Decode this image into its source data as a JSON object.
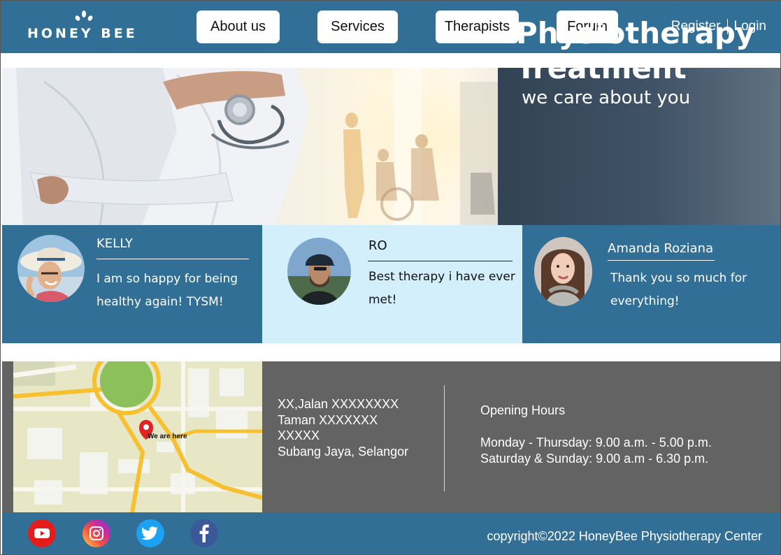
{
  "brand": {
    "name": "HONEY BEE"
  },
  "nav": {
    "items": [
      {
        "label": "About us"
      },
      {
        "label": "Services"
      },
      {
        "label": "Therapists"
      },
      {
        "label": "Forum"
      }
    ],
    "register_label": "Register",
    "login_label": "Login"
  },
  "hero": {
    "title_line1": "Physiotherapy",
    "title_line2": "Treatment",
    "subtitle": "we care about you"
  },
  "testimonials": [
    {
      "name": "KELLY",
      "text": "I am so happy for being healthy again! TYSM!"
    },
    {
      "name": "RO",
      "text": "Best therapy i have ever met!"
    },
    {
      "name": "Amanda Roziana",
      "text": "Thank you so much for everything!"
    }
  ],
  "map": {
    "marker_label": "We are here"
  },
  "address": {
    "line1": "XX,Jalan XXXXXXXX",
    "line2": "Taman XXXXXXX",
    "line3": "XXXXX",
    "line4": "Subang Jaya, Selangor"
  },
  "hours": {
    "title": "Opening Hours",
    "weekday": "Monday - Thursday: 9.00 a.m. - 5.00 p.m.",
    "weekend": "Saturday & Sunday: 9.00 a.m - 6.30 p.m."
  },
  "footer": {
    "social": [
      "youtube-icon",
      "instagram-icon",
      "twitter-icon",
      "facebook-icon"
    ],
    "copyright": "copyright©2022 HoneyBee Physiotherapy Center"
  },
  "colors": {
    "primary": "#326f97",
    "light_panel": "#d3effc",
    "contact_bg": "#636363",
    "youtube": "#e51c1c",
    "twitter": "#1da1f2",
    "facebook": "#3b5998"
  }
}
